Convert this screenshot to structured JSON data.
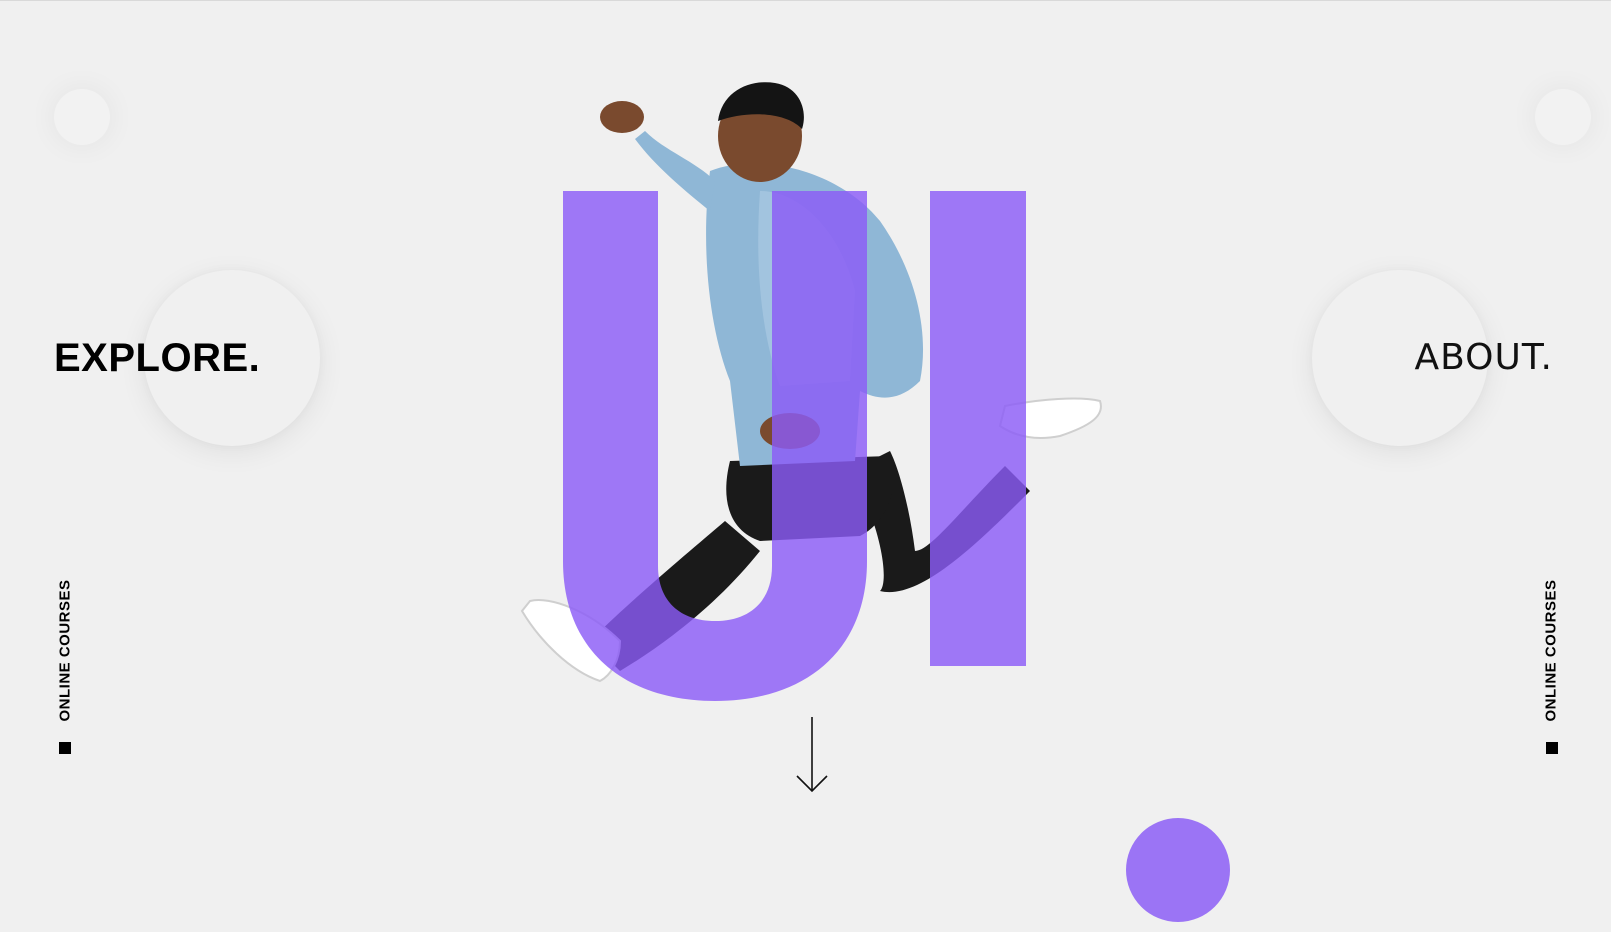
{
  "nav": {
    "explore_label": "EXPLORE.",
    "about_label": "ABOUT."
  },
  "hero": {
    "big_text": "UI"
  },
  "side": {
    "left_label": "ONLINE COURSES",
    "right_label": "ONLINE COURSES"
  },
  "colors": {
    "background": "#f0f0f0",
    "accent": "#9b74f5",
    "text": "#000000"
  },
  "icons": {
    "scroll": "arrow-down-icon"
  }
}
